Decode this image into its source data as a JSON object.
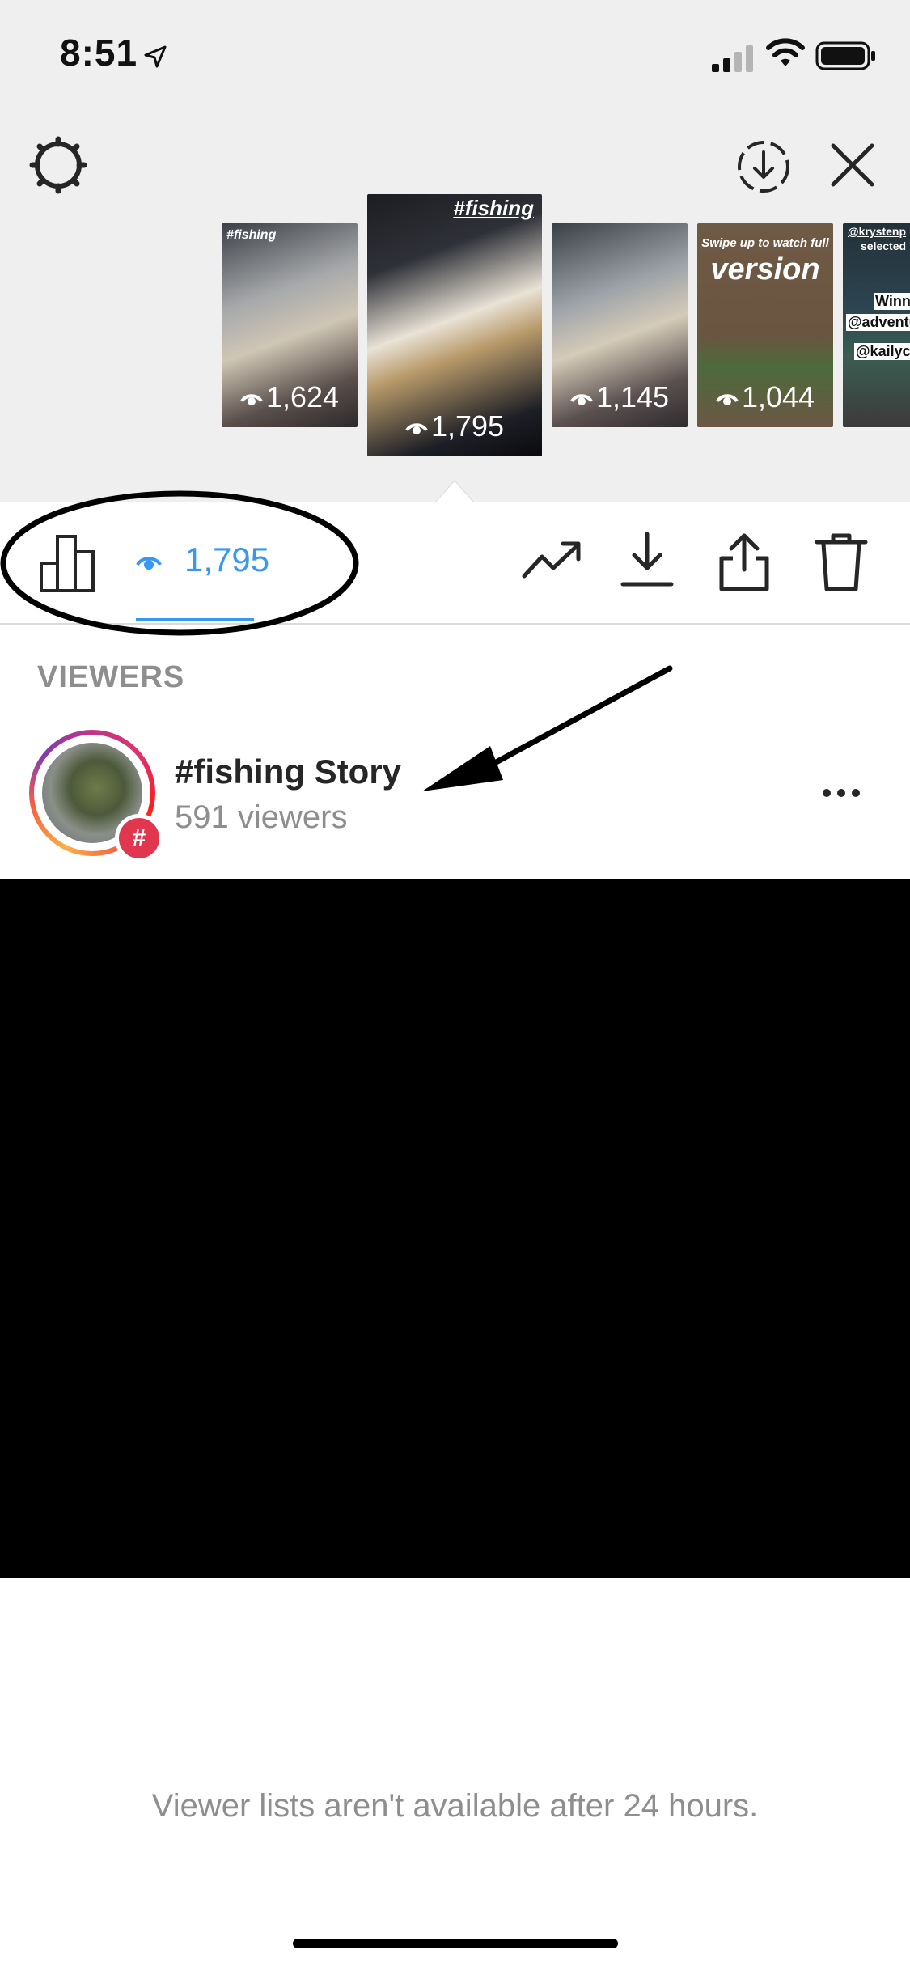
{
  "status_bar": {
    "time": "8:51"
  },
  "thumbnails": [
    {
      "tag": "#fishing",
      "views": "1,624"
    },
    {
      "tag": "#fishing",
      "views": "1,795",
      "selected": true
    },
    {
      "tag": "",
      "views": "1,145"
    },
    {
      "line1": "Swipe up to watch full",
      "line2": "version",
      "views": "1,044"
    },
    {
      "tag": "@krystenp",
      "lines": [
        "selected",
        "Winne",
        "@adventu",
        "@kailyca"
      ]
    }
  ],
  "toolbar": {
    "views_count": "1,795"
  },
  "viewers": {
    "header": "VIEWERS",
    "item": {
      "title": "#fishing Story",
      "subtitle": "591 viewers",
      "badge": "#"
    }
  },
  "footer": {
    "note": "Viewer lists aren't available after 24 hours."
  },
  "colors": {
    "accent": "#3897f0",
    "badge": "#e0374f",
    "muted": "#8e8e8e"
  }
}
